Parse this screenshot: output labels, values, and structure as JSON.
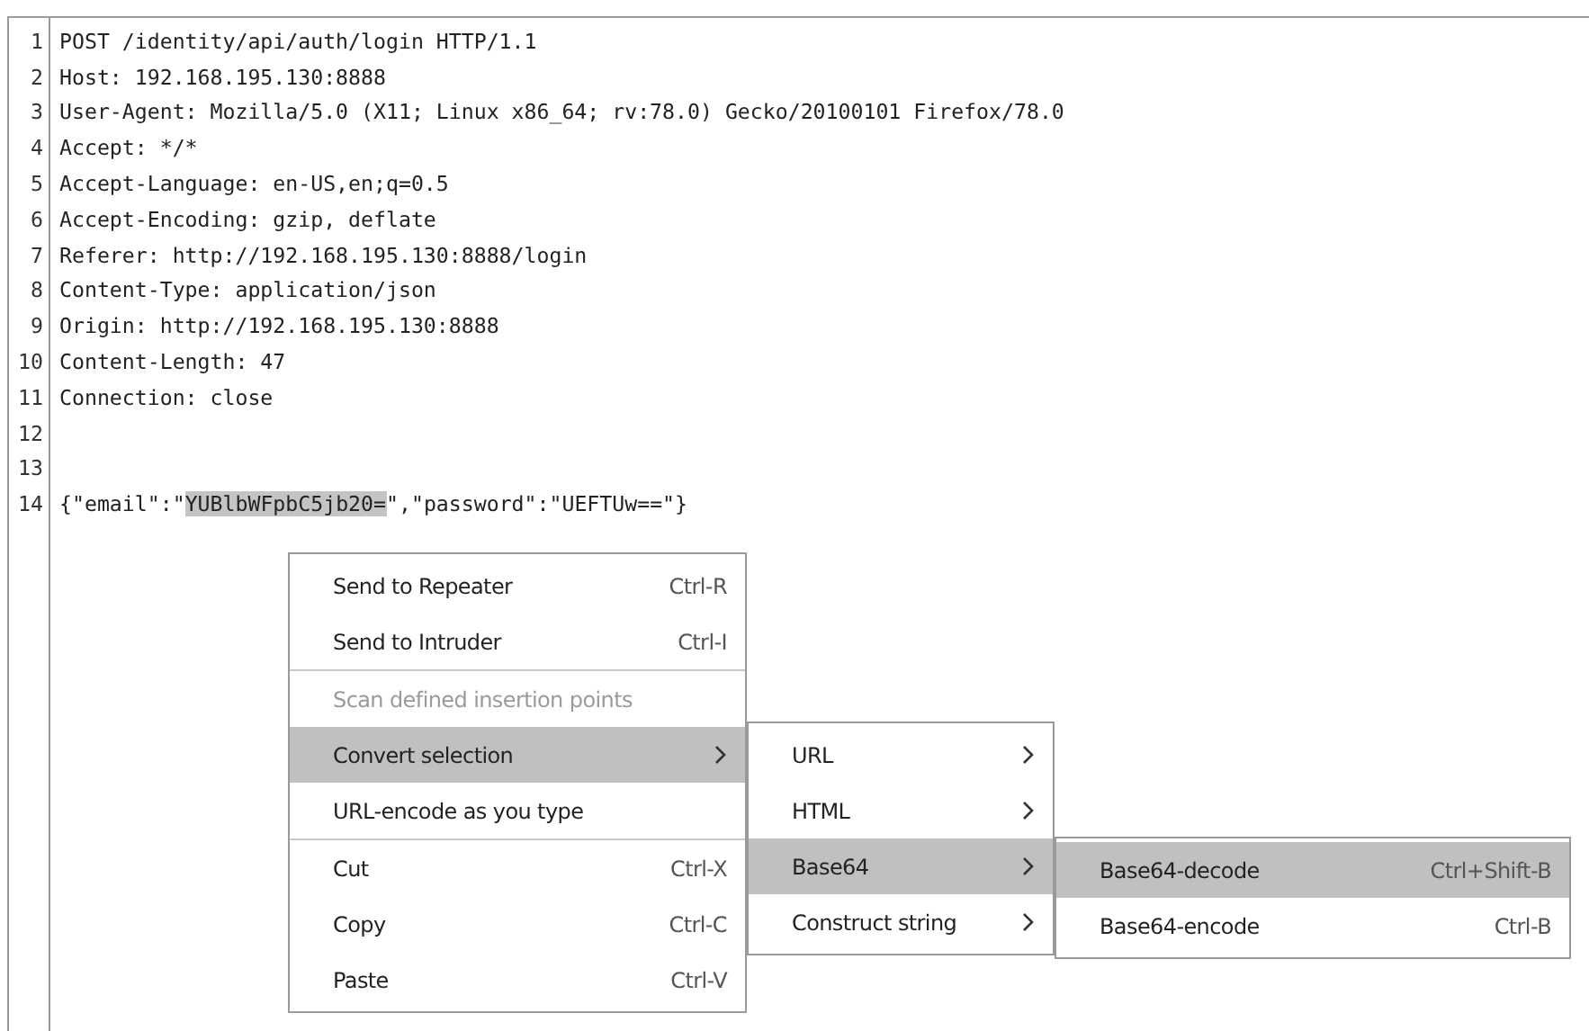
{
  "editor": {
    "lines": [
      {
        "number": "1",
        "segments": [
          {
            "text": "POST /identity/api/auth/login HTTP/1.1",
            "selected": false
          }
        ]
      },
      {
        "number": "2",
        "segments": [
          {
            "text": "Host: 192.168.195.130:8888",
            "selected": false
          }
        ]
      },
      {
        "number": "3",
        "segments": [
          {
            "text": "User-Agent: Mozilla/5.0 (X11; Linux x86_64; rv:78.0) Gecko/20100101 Firefox/78.0",
            "selected": false
          }
        ]
      },
      {
        "number": "4",
        "segments": [
          {
            "text": "Accept: */*",
            "selected": false
          }
        ]
      },
      {
        "number": "5",
        "segments": [
          {
            "text": "Accept-Language: en-US,en;q=0.5",
            "selected": false
          }
        ]
      },
      {
        "number": "6",
        "segments": [
          {
            "text": "Accept-Encoding: gzip, deflate",
            "selected": false
          }
        ]
      },
      {
        "number": "7",
        "segments": [
          {
            "text": "Referer: http://192.168.195.130:8888/login",
            "selected": false
          }
        ]
      },
      {
        "number": "8",
        "segments": [
          {
            "text": "Content-Type: application/json",
            "selected": false
          }
        ]
      },
      {
        "number": "9",
        "segments": [
          {
            "text": "Origin: http://192.168.195.130:8888",
            "selected": false
          }
        ]
      },
      {
        "number": "10",
        "segments": [
          {
            "text": "Content-Length: 47",
            "selected": false
          }
        ]
      },
      {
        "number": "11",
        "segments": [
          {
            "text": "Connection: close",
            "selected": false
          }
        ]
      },
      {
        "number": "12"
      },
      {
        "number": "13"
      },
      {
        "number": "14",
        "segments": [
          {
            "text": "{\"email\":\"",
            "selected": false
          },
          {
            "text": "YUBlbWFpbC5jb20=",
            "selected": true
          },
          {
            "text": "\",\"password\":\"UEFTUw==\"}",
            "selected": false
          }
        ]
      }
    ]
  },
  "context_menu": {
    "items": [
      {
        "kind": "item",
        "label": "Send to Repeater",
        "shortcut": "Ctrl-R",
        "disabled": false,
        "selected": false,
        "submenu": false
      },
      {
        "kind": "item",
        "label": "Send to Intruder",
        "shortcut": "Ctrl-I",
        "disabled": false,
        "selected": false,
        "submenu": false
      },
      {
        "kind": "separator"
      },
      {
        "kind": "item",
        "label": "Scan defined insertion points",
        "disabled": true,
        "selected": false,
        "submenu": false
      },
      {
        "kind": "item",
        "label": "Convert selection",
        "disabled": false,
        "selected": true,
        "submenu": true
      },
      {
        "kind": "item",
        "label": "URL-encode as you type",
        "disabled": false,
        "selected": false,
        "submenu": false
      },
      {
        "kind": "separator"
      },
      {
        "kind": "item",
        "label": "Cut",
        "shortcut": "Ctrl-X",
        "disabled": false,
        "selected": false,
        "submenu": false
      },
      {
        "kind": "item",
        "label": "Copy",
        "shortcut": "Ctrl-C",
        "disabled": false,
        "selected": false,
        "submenu": false
      },
      {
        "kind": "item",
        "label": "Paste",
        "shortcut": "Ctrl-V",
        "disabled": false,
        "selected": false,
        "submenu": false
      }
    ]
  },
  "convert_submenu": {
    "items": [
      {
        "kind": "item",
        "label": "URL",
        "disabled": false,
        "selected": false,
        "submenu": true
      },
      {
        "kind": "item",
        "label": "HTML",
        "disabled": false,
        "selected": false,
        "submenu": true
      },
      {
        "kind": "item",
        "label": "Base64",
        "disabled": false,
        "selected": true,
        "submenu": true
      },
      {
        "kind": "item",
        "label": "Construct string",
        "disabled": false,
        "selected": false,
        "submenu": true
      }
    ]
  },
  "base64_submenu": {
    "items": [
      {
        "kind": "item",
        "label": "Base64-decode",
        "shortcut": "Ctrl+Shift-B",
        "disabled": false,
        "selected": true,
        "submenu": false
      },
      {
        "kind": "item",
        "label": "Base64-encode",
        "shortcut": "Ctrl-B",
        "disabled": false,
        "selected": false,
        "submenu": false
      }
    ]
  }
}
